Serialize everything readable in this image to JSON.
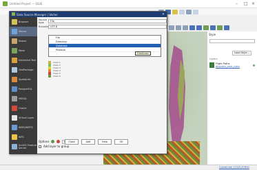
{
  "window": {
    "title": "Untitled Project — QGIS",
    "controls": [
      "–",
      "□",
      "×"
    ]
  },
  "dialog": {
    "title": "Data Source Manager | Vector",
    "close": "×",
    "sidebar": [
      {
        "label": "Browser",
        "color": "#d4c35b"
      },
      {
        "label": "Vector",
        "color": "#6fa3d8",
        "active": true
      },
      {
        "label": "Raster",
        "color": "#caa36a"
      },
      {
        "label": "Mesh",
        "color": "#7aa35a"
      },
      {
        "label": "Delimited Text",
        "color": "#d7a23f"
      },
      {
        "label": "GeoPackage",
        "color": "#b2c7e2"
      },
      {
        "label": "SpatiaLite",
        "color": "#d98a3a"
      },
      {
        "label": "PostgreSQL",
        "color": "#5f8ec6"
      },
      {
        "label": "MSSQL",
        "color": "#9c9c9c"
      },
      {
        "label": "Oracle",
        "color": "#d24a3a"
      },
      {
        "label": "Virtual Layer",
        "color": "#e6e6e6"
      },
      {
        "label": "WMS/WMTS",
        "color": "#6b9bd2"
      },
      {
        "label": "WFS",
        "color": "#ecc34b"
      },
      {
        "label": "ArcGIS Feature Server",
        "color": "#8fb0d9"
      }
    ],
    "fields": [
      {
        "label": "Source type",
        "value": "File"
      },
      {
        "label": "Encoding",
        "value": "UTF-8"
      }
    ],
    "dropdown": {
      "options": [
        "File",
        "Directory",
        "Database",
        "Protocol"
      ],
      "selected_index": 2
    },
    "tooltip": "Database",
    "legend": [
      {
        "color": "#c9b04a",
        "label": "Class 1"
      },
      {
        "color": "#7fbf5a",
        "label": "Class 2"
      },
      {
        "color": "#d6d63b",
        "label": "Class 3"
      },
      {
        "color": "#e08a38",
        "label": "Class 4"
      },
      {
        "color": "#c24a3a",
        "label": "Class 5"
      },
      {
        "color": "#6a9b48",
        "label": "Class 6"
      }
    ],
    "bottom": {
      "options_label": "Options",
      "crs_field": "EPSG:4326",
      "checkbox_label": "Add layer to group",
      "buttons": [
        "Close",
        "Add",
        "Help",
        "OK"
      ]
    }
  },
  "right_panel": {
    "heading": "Style",
    "button": "Load Style...",
    "section_label": "Layers",
    "item_title": "Flight Paths",
    "item_link": "airspace_area_class"
  },
  "status": {
    "link": "Coordinate 12345,67890"
  }
}
